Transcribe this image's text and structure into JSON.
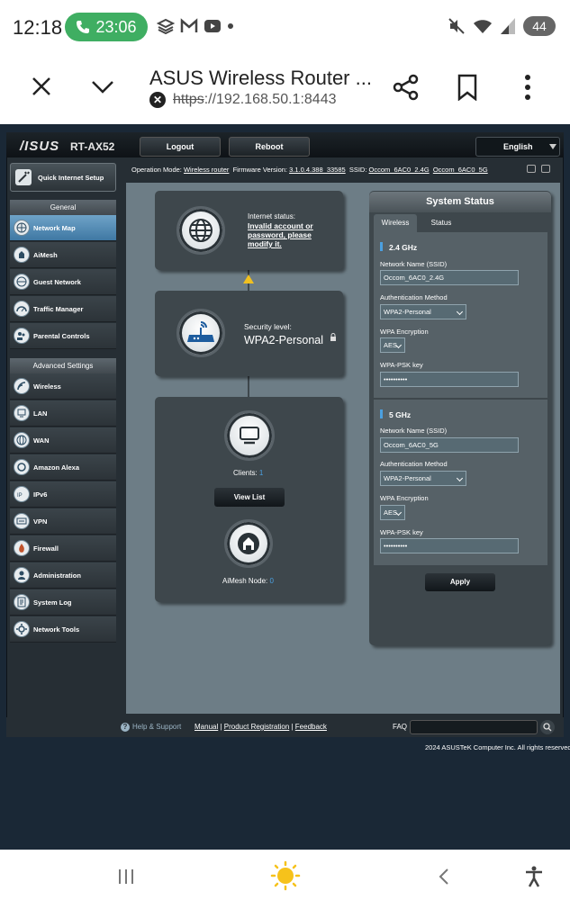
{
  "statusbar": {
    "time": "12:18",
    "call_timer": "23:06",
    "battery": "44",
    "notification_icons": [
      "stack-icon",
      "gmail-icon",
      "youtube-icon",
      "dot-icon"
    ],
    "system_icons": [
      "mute-icon",
      "wifi-icon",
      "signal-icon"
    ]
  },
  "browser": {
    "page_title": "ASUS Wireless Router ...",
    "url_scheme": "https",
    "url_rest": "://192.168.50.1:8443"
  },
  "router": {
    "brand": "/ISUS",
    "model": "RT-AX52",
    "header_buttons": {
      "logout": "Logout",
      "reboot": "Reboot"
    },
    "language": "English",
    "info": {
      "opmode_label": "Operation Mode:",
      "opmode_value": "Wireless router",
      "fw_label": "Firmware Version:",
      "fw_value": "3.1.0.4.388_33585",
      "ssid_label": "SSID:",
      "ssid_24": "Occom_6AC0_2.4G",
      "ssid_5": "Occom_6AC0_5G"
    },
    "nav": {
      "quick_setup": "Quick Internet Setup",
      "general_header": "General",
      "general": [
        "Network Map",
        "AiMesh",
        "Guest Network",
        "Traffic Manager",
        "Parental Controls"
      ],
      "advanced_header": "Advanced Settings",
      "advanced": [
        "Wireless",
        "LAN",
        "WAN",
        "Amazon Alexa",
        "IPv6",
        "VPN",
        "Firewall",
        "Administration",
        "System Log",
        "Network Tools"
      ]
    },
    "map": {
      "internet_status_label": "Internet status:",
      "internet_status_value": "Invalid account or password, please modify it.",
      "security_level_label": "Security level:",
      "security_level_value": "WPA2-Personal",
      "clients_label": "Clients:",
      "clients_count": "1",
      "view_list": "View List",
      "aimesh_label": "AiMesh Node:",
      "aimesh_count": "0"
    },
    "system_status": {
      "title": "System Status",
      "tabs": [
        "Wireless",
        "Status"
      ],
      "bands": [
        {
          "name": "2.4 GHz",
          "ssid_label": "Network Name (SSID)",
          "ssid": "Occom_6AC0_2.4G",
          "auth_label": "Authentication Method",
          "auth": "WPA2-Personal",
          "enc_label": "WPA Encryption",
          "enc": "AES",
          "key_label": "WPA-PSK key",
          "key": "••••••••••"
        },
        {
          "name": "5 GHz",
          "ssid_label": "Network Name (SSID)",
          "ssid": "Occom_6AC0_5G",
          "auth_label": "Authentication Method",
          "auth": "WPA2-Personal",
          "enc_label": "WPA Encryption",
          "enc": "AES",
          "key_label": "WPA-PSK key",
          "key": "••••••••••"
        }
      ],
      "apply": "Apply"
    },
    "footer": {
      "help": "Help & Support",
      "manual": "Manual",
      "sep1": " | ",
      "registration": "Product Registration",
      "sep2": " | ",
      "feedback": "Feedback",
      "faq": "FAQ",
      "copyright": "2024 ASUSTeK Computer Inc. All rights reserved."
    }
  },
  "colors": {
    "accent_blue": "#4ba0e0",
    "active_nav": "#3f78a3",
    "call_green": "#3fae62",
    "warning_yellow": "#f0c020"
  }
}
